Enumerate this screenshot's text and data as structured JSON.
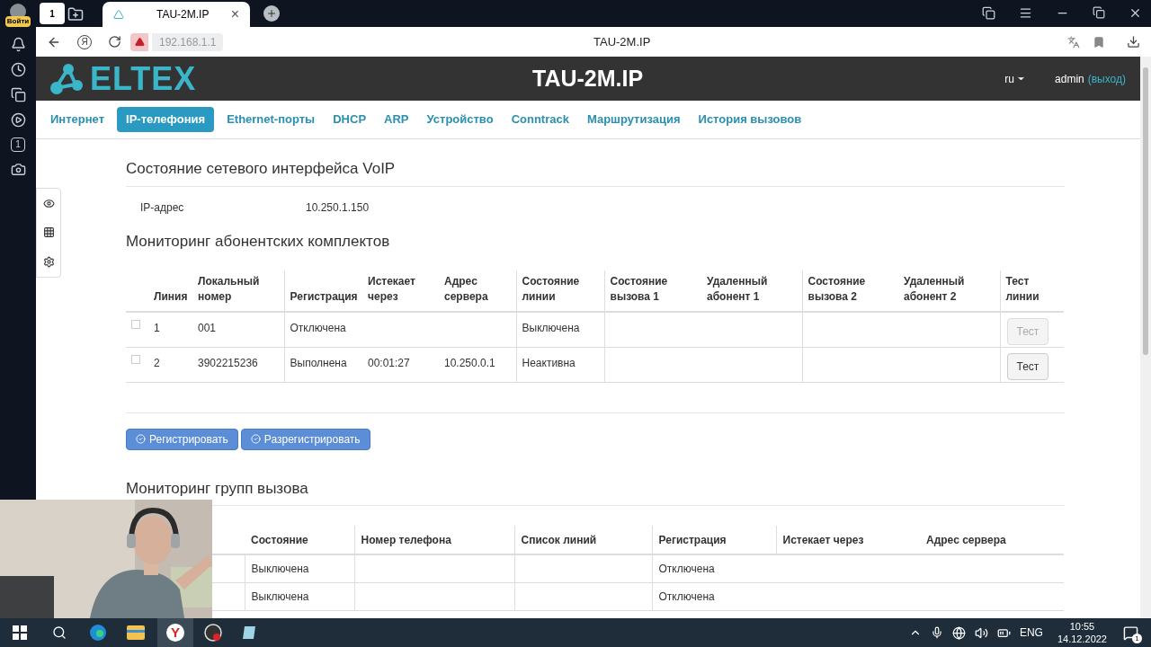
{
  "browser": {
    "profile_label": "Войти",
    "home_count": "1",
    "side_count": "1",
    "tab_title": "TAU-2M.IP",
    "tab_close": "×",
    "logo_letter": "Я",
    "address": "192.168.1.1",
    "page_title": "TAU-2M.IP"
  },
  "header": {
    "brand": "ELTEX",
    "title": "TAU-2M.IP",
    "lang": "ru",
    "user": "admin",
    "logout": "(выход)"
  },
  "nav": [
    {
      "label": "Интернет",
      "selected": false
    },
    {
      "label": "IP-телефония",
      "selected": true
    },
    {
      "label": "Ethernet-порты",
      "selected": false
    },
    {
      "label": "DHCP",
      "selected": false
    },
    {
      "label": "ARP",
      "selected": false
    },
    {
      "label": "Устройство",
      "selected": false
    },
    {
      "label": "Conntrack",
      "selected": false
    },
    {
      "label": "Маршрутизация",
      "selected": false
    },
    {
      "label": "История вызовов",
      "selected": false
    }
  ],
  "voip": {
    "title": "Состояние сетевого интерфейса VoIP",
    "fields": [
      {
        "label": "IP-адрес",
        "value": "10.250.1.150"
      }
    ]
  },
  "subscribers": {
    "title": "Мониторинг абонентских комплектов",
    "columns": [
      "Линия",
      "Локальный номер",
      "Регистрация",
      "Истекает через",
      "Адрес сервера",
      "Состояние линии",
      "Состояние вызова 1",
      "Удаленный абонент 1",
      "Состояние вызова 2",
      "Удаленный абонент 2",
      "Тест линии"
    ],
    "rows": [
      {
        "checked": false,
        "line": "1",
        "number": "001",
        "registration": "Отключена",
        "line_state": "Выключена",
        "test": {
          "label": "Тест",
          "disabled": true
        }
      },
      {
        "checked": false,
        "line": "2",
        "number": "3902215236",
        "registration": "Выполнена",
        "expires": "00:01:27",
        "server": "10.250.0.1",
        "line_state": "Неактивна",
        "test": {
          "label": "Тест",
          "disabled": false
        }
      }
    ],
    "buttons": [
      "Регистрировать",
      "Разрегистрировать"
    ]
  },
  "groups": {
    "title": "Мониторинг групп вызова",
    "columns": [
      "Состояние",
      "Номер телефона",
      "Список линий",
      "Регистрация",
      "Истекает через",
      "Адрес сервера"
    ],
    "rows": [
      {
        "state": "Выключена",
        "registration": "Отключена"
      },
      {
        "state": "Выключена",
        "registration": "Отключена"
      }
    ]
  },
  "taskbar": {
    "browser_letter": "Y",
    "lang": "ENG",
    "time": "10:55",
    "date": "14.12.2022",
    "notifications": "1"
  }
}
